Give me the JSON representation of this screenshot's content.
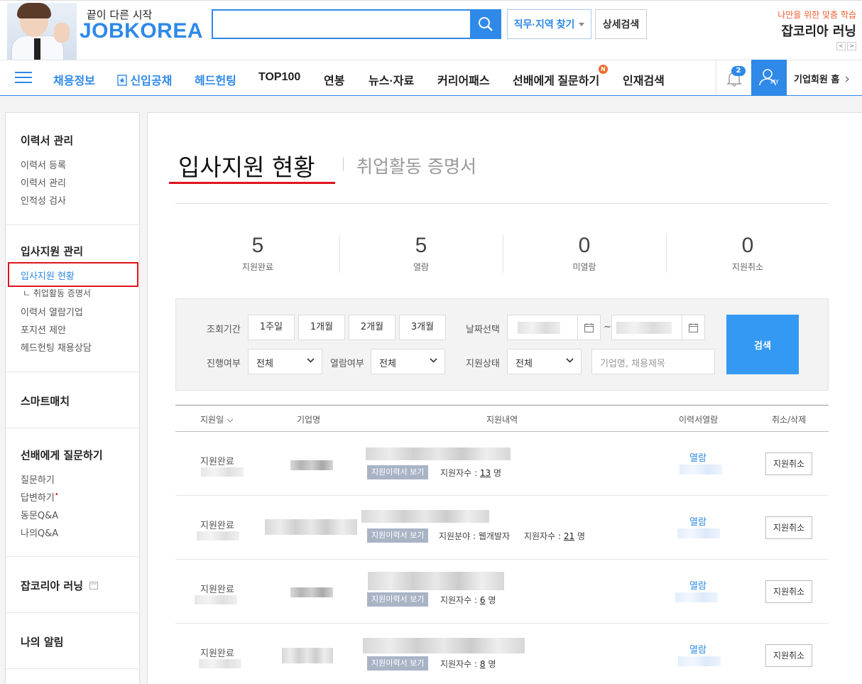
{
  "header": {
    "slogan": "끝이 다른 시작",
    "logo": "JOBKOREA",
    "search_placeholder": "",
    "job_region_button": "직무·지역 찾기",
    "detail_search_button": "상세검색",
    "promo_sub": "나만을 위한 맞춤 학습",
    "promo_main": "잡코리아 러닝",
    "promo_prev": "<",
    "promo_next": ">"
  },
  "nav": {
    "items": [
      "채용정보",
      "신입공채",
      "헤드헌팅",
      "TOP100",
      "연봉",
      "뉴스·자료",
      "커리어패스",
      "선배에게 질문하기",
      "인재검색"
    ],
    "new_badge": "N",
    "notification_count": "2",
    "my_label": "MY",
    "corp_home": "기업회원 홈"
  },
  "sidebar": {
    "resume_title": "이력서 관리",
    "resume_links": [
      "이력서 등록",
      "이력서 관리",
      "인적성 검사"
    ],
    "apply_title": "입사지원 관리",
    "apply_links": [
      "입사지원 현황",
      "ㄴ 취업활동 증명서",
      "이력서 열람기업",
      "포지션 제안",
      "헤드헌팅 채용상담"
    ],
    "smart_title": "스마트매치",
    "ask_title": "선배에게 질문하기",
    "ask_links": [
      "질문하기",
      "답변하기",
      "동문Q&A",
      "나의Q&A"
    ],
    "learning_title": "잡코리아 러닝",
    "alert_title": "나의 알림"
  },
  "main": {
    "title": "입사지원 현황",
    "sub_title": "취업활동 증명서",
    "stats": [
      {
        "value": "5",
        "label": "지원완료"
      },
      {
        "value": "5",
        "label": "열람"
      },
      {
        "value": "0",
        "label": "미열람"
      },
      {
        "value": "0",
        "label": "지원취소"
      }
    ],
    "filter": {
      "period_label": "조회기간",
      "period_buttons": [
        "1주일",
        "1개월",
        "2개월",
        "3개월"
      ],
      "date_label": "날짜선택",
      "date_sep": "~",
      "progress_label": "진행여부",
      "progress_value": "전체",
      "read_label": "열람여부",
      "read_value": "전체",
      "status_label": "지원상태",
      "status_value": "전체",
      "keyword_placeholder": "기업명, 채용제목",
      "search_button": "검색"
    },
    "table": {
      "headers": [
        "지원일",
        "기업명",
        "지원내역",
        "이력서열람",
        "취소/삭제"
      ],
      "resume_tag": "지원이력서 보기",
      "rows": [
        {
          "status": "지원완료",
          "info": "지원자수 :",
          "count": "13",
          "unit": "명",
          "field": "",
          "view": "열람",
          "cancel": "지원취소"
        },
        {
          "status": "지원완료",
          "info": "지원자수 :",
          "count": "21",
          "unit": "명",
          "field": "지원분야 : 웹개발자",
          "view": "열람",
          "cancel": "지원취소"
        },
        {
          "status": "지원완료",
          "info": "지원자수 :",
          "count": "6",
          "unit": "명",
          "field": "",
          "view": "열람",
          "cancel": "지원취소"
        },
        {
          "status": "지원완료",
          "info": "지원자수 :",
          "count": "8",
          "unit": "명",
          "field": "",
          "view": "열람",
          "cancel": "지원취소"
        }
      ]
    }
  },
  "colors": {
    "brand_blue": "#2e89e8",
    "highlight_red": "#e0141e",
    "badge_orange": "#ef6a2d"
  }
}
